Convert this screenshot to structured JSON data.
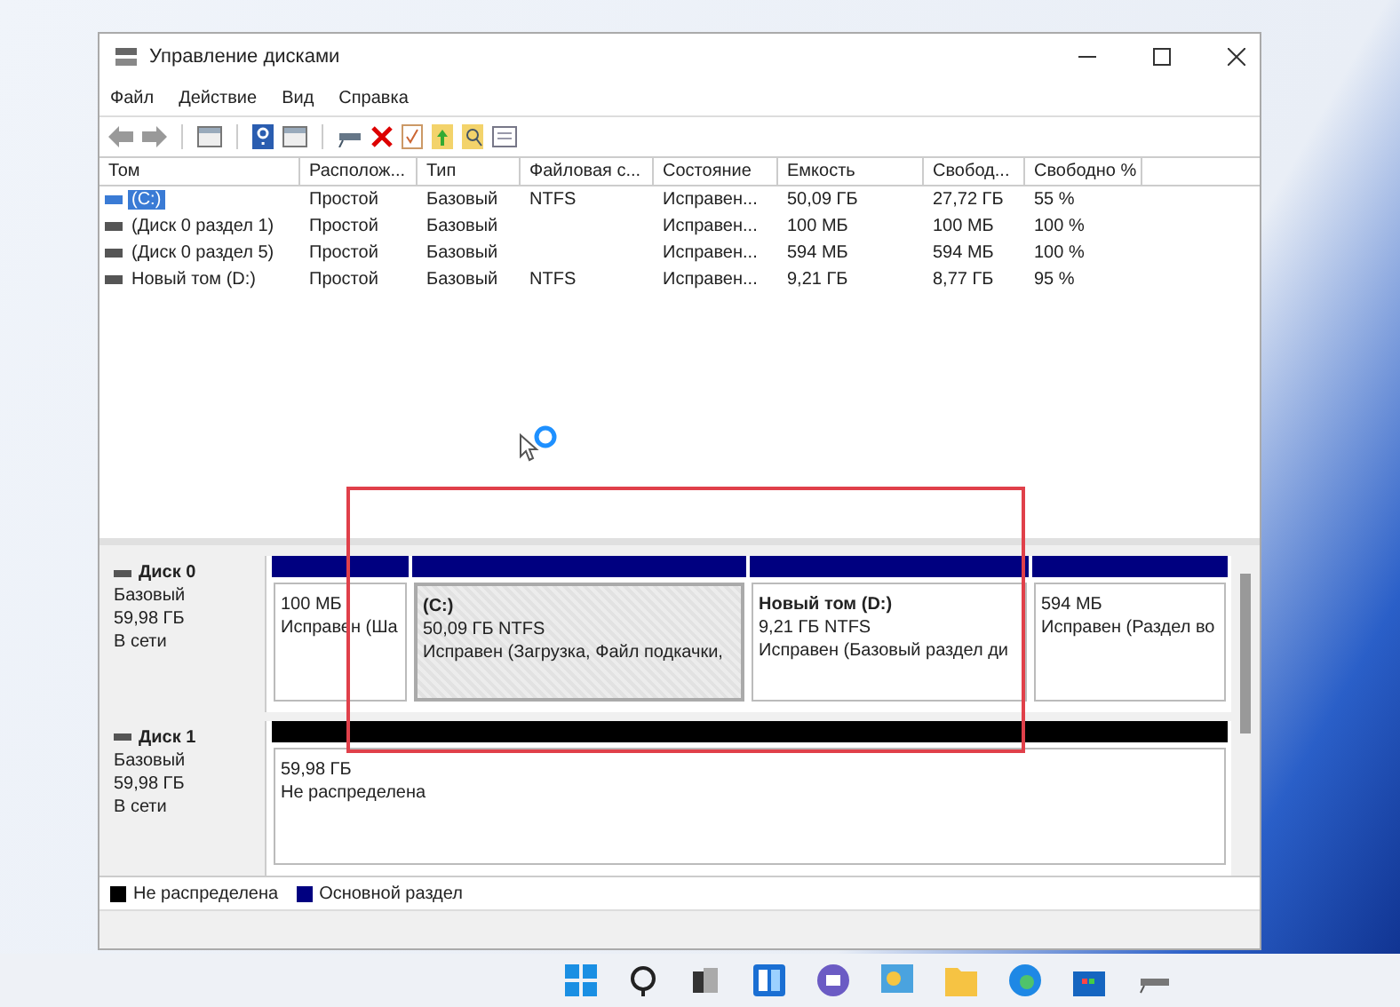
{
  "window": {
    "title": "Управление дисками"
  },
  "menu": [
    "Файл",
    "Действие",
    "Вид",
    "Справка"
  ],
  "table": {
    "columns": [
      "Том",
      "Располож...",
      "Тип",
      "Файловая с...",
      "Состояние",
      "Емкость",
      "Свобод...",
      "Свободно %"
    ],
    "rows": [
      {
        "selected": true,
        "cells": [
          "(C:)",
          "Простой",
          "Базовый",
          "NTFS",
          "Исправен...",
          "50,09 ГБ",
          "27,72 ГБ",
          "55 %"
        ]
      },
      {
        "selected": false,
        "cells": [
          "(Диск 0 раздел 1)",
          "Простой",
          "Базовый",
          "",
          "Исправен...",
          "100 МБ",
          "100 МБ",
          "100 %"
        ]
      },
      {
        "selected": false,
        "cells": [
          "(Диск 0 раздел 5)",
          "Простой",
          "Базовый",
          "",
          "Исправен...",
          "594 МБ",
          "594 МБ",
          "100 %"
        ]
      },
      {
        "selected": false,
        "cells": [
          "Новый том (D:)",
          "Простой",
          "Базовый",
          "NTFS",
          "Исправен...",
          "9,21 ГБ",
          "8,77 ГБ",
          "95 %"
        ]
      }
    ]
  },
  "disks": [
    {
      "name": "Диск 0",
      "type": "Базовый",
      "size": "59,98 ГБ",
      "status": "В сети",
      "partitions": [
        {
          "size": "100 МБ",
          "status": "Исправен (Ша",
          "color": "#000080",
          "selected": false
        },
        {
          "name": "(C:)",
          "size": "50,09 ГБ NTFS",
          "status": "Исправен (Загрузка, Файл подкачки,",
          "color": "#000080",
          "selected": true
        },
        {
          "name": "Новый том  (D:)",
          "size": "9,21 ГБ NTFS",
          "status": "Исправен (Базовый раздел ди",
          "color": "#000080",
          "selected": false
        },
        {
          "size": "594 МБ",
          "status": "Исправен (Раздел во",
          "color": "#000080",
          "selected": false
        }
      ]
    },
    {
      "name": "Диск 1",
      "type": "Базовый",
      "size": "59,98 ГБ",
      "status": "В сети",
      "partitions": [
        {
          "size": "59,98 ГБ",
          "status": "Не распределена",
          "color": "#000000",
          "selected": false
        }
      ]
    }
  ],
  "legend": [
    {
      "label": "Не распределена",
      "color": "#000000"
    },
    {
      "label": "Основной раздел",
      "color": "#000080"
    }
  ]
}
